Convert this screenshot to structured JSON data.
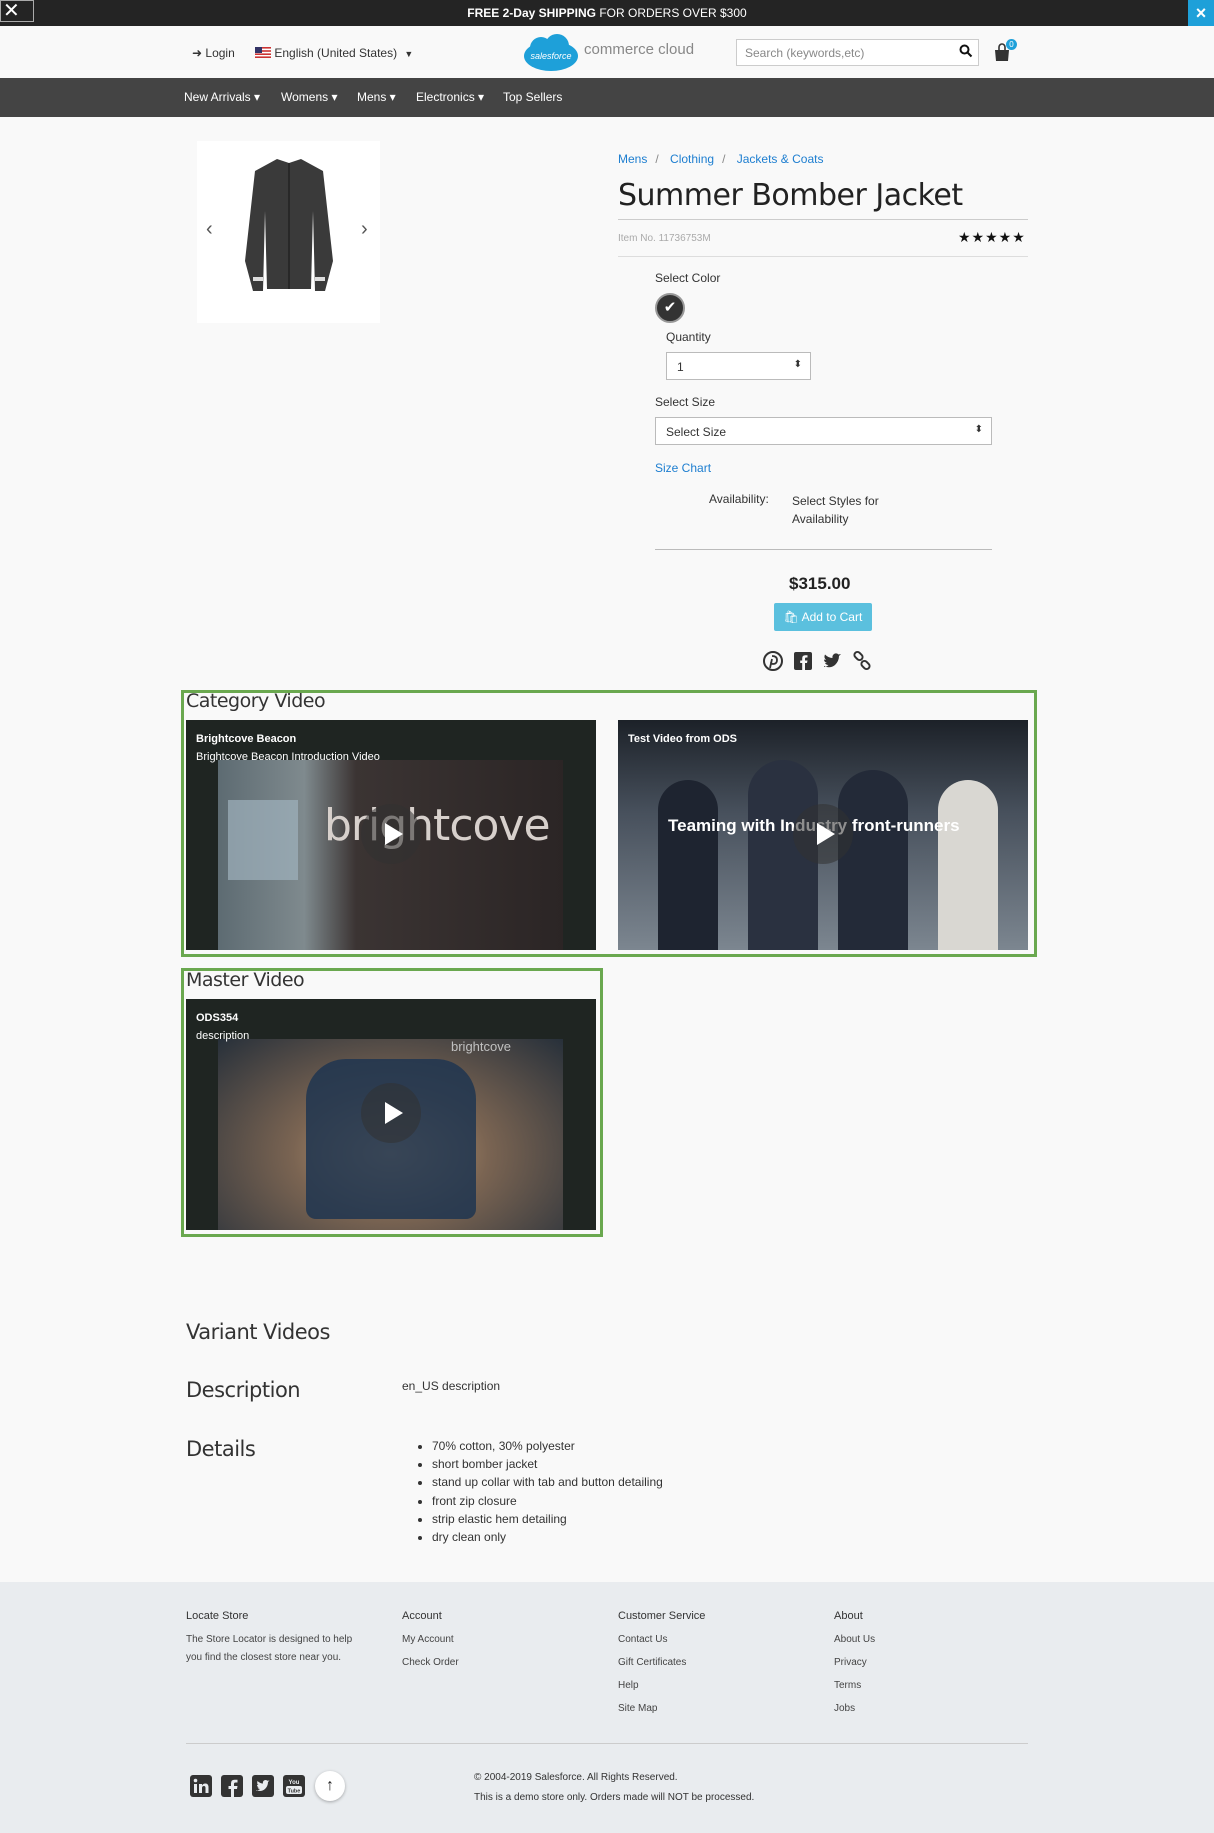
{
  "promo": {
    "bold": "FREE 2-Day SHIPPING",
    "rest": " FOR ORDERS OVER $300",
    "close": "×"
  },
  "header": {
    "login": "Login",
    "locale": "English (United States)",
    "logo_badge": "salesforce",
    "logo_text": "commerce cloud",
    "search_placeholder": "Search (keywords,etc)",
    "cart_count": "0"
  },
  "nav": [
    {
      "label": "New Arrivals"
    },
    {
      "label": "Womens"
    },
    {
      "label": "Mens"
    },
    {
      "label": "Electronics"
    },
    {
      "label": "Top Sellers"
    }
  ],
  "product": {
    "breadcrumb": [
      "Mens",
      "Clothing",
      "Jackets & Coats"
    ],
    "title": "Summer Bomber Jacket",
    "item_no": "Item No. 11736753M",
    "rating_stars": 5,
    "select_color_label": "Select Color",
    "quantity_label": "Quantity",
    "quantity_value": "1",
    "select_size_label": "Select Size",
    "size_value": "Select Size",
    "size_chart": "Size Chart",
    "availability_label": "Availability:",
    "availability_value_1": "Select Styles for",
    "availability_value_2": "Availability",
    "price": "$315.00",
    "add_to_cart": "Add to Cart"
  },
  "category_video": {
    "title": "Category Video",
    "videos": [
      {
        "title": "Brightcove Beacon",
        "subtitle": "Brightcove Beacon Introduction Video",
        "overlay": "brightcove"
      },
      {
        "title": "Test Video from ODS",
        "subtitle": "",
        "overlay": "Teaming with Industry front-runners"
      }
    ]
  },
  "master_video": {
    "title": "Master Video",
    "video": {
      "title": "ODS354",
      "subtitle": "description",
      "overlay": "brightcove"
    }
  },
  "variant_videos": {
    "title": "Variant Videos"
  },
  "description": {
    "title": "Description",
    "text": "en_US description"
  },
  "details": {
    "title": "Details",
    "items": [
      "70% cotton, 30% polyester",
      "short bomber jacket",
      "stand up collar with tab and button detailing",
      "front zip closure",
      "strip elastic hem detailing",
      "dry clean only"
    ]
  },
  "footer": {
    "locate_store": "Locate Store",
    "locate_text_1": "The Store Locator is designed to help",
    "locate_text_2": "you find the closest store near you.",
    "account": "Account",
    "account_links": [
      "My Account",
      "Check Order"
    ],
    "customer_service": "Customer Service",
    "cs_links": [
      "Contact Us",
      "Gift Certificates",
      "Help",
      "Site Map"
    ],
    "about": "About",
    "about_links": [
      "About Us",
      "Privacy",
      "Terms",
      "Jobs"
    ],
    "copyright": "© 2004-2019 Salesforce. All Rights Reserved.",
    "disclaimer": "This is a demo store only. Orders made will NOT be processed."
  },
  "colors": {
    "promo_bg": "#242424",
    "accent_blue": "#1ea0d9",
    "nav_bg": "#444444",
    "add_to_cart": "#5bc0de",
    "highlight_border": "#6aa84f",
    "footer_bg": "#e9ecef"
  }
}
